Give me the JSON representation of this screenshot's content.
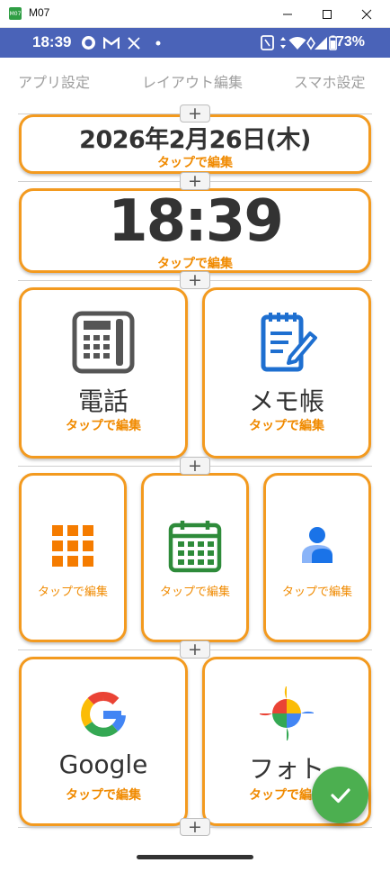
{
  "window": {
    "title": "M07",
    "app_icon_text": "M07"
  },
  "status_bar": {
    "time": "18:39",
    "battery": "73%"
  },
  "tabs": [
    "アプリ設定",
    "レイアウト編集",
    "スマホ設定"
  ],
  "widgets": {
    "edit_label": "タップで編集",
    "date": "2026年2月26日(木)",
    "clock": "18:39",
    "phone": "電話",
    "memo": "メモ帳",
    "google": "Google",
    "photos": "フォト"
  },
  "add_button": "+",
  "colors": {
    "accent": "#f39a1f",
    "status_bar": "#4a63b8",
    "fab": "#4caf50"
  },
  "icons": [
    "phone-icon",
    "memo-icon",
    "apps-grid-icon",
    "calendar-icon",
    "contacts-icon",
    "google-icon",
    "photos-icon",
    "check-icon"
  ]
}
